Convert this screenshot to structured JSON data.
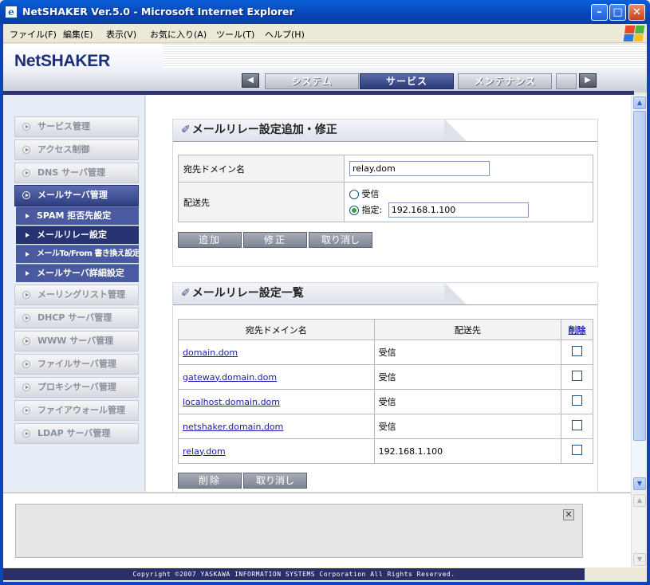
{
  "window": {
    "title": "NetSHAKER Ver.5.0 - Microsoft Internet Explorer",
    "min": "–",
    "max": "□",
    "close": "✕"
  },
  "menu": [
    "ファイル(F)",
    "編集(E)",
    "表示(V)",
    "お気に入り(A)",
    "ツール(T)",
    "ヘルプ(H)"
  ],
  "logo": "NetSHAKER",
  "tabs": {
    "prev": "◀",
    "next": "▶",
    "items": [
      "システム",
      "サービス",
      "メンテナンス"
    ],
    "active": "サービス"
  },
  "sidebar": {
    "items": [
      "サービス管理",
      "アクセス制御",
      "DNS サーバ管理",
      "メールサーバ管理",
      "メーリングリスト管理",
      "DHCP サーバ管理",
      "WWW サーバ管理",
      "ファイルサーバ管理",
      "プロキシサーバ管理",
      "ファイアウォール管理",
      "LDAP サーバ管理"
    ],
    "active": "メールサーバ管理",
    "subitems": [
      "SPAM 拒否先設定",
      "メールリレー設定",
      "メールTo/From 書き換え設定",
      "メールサーバ詳細設定"
    ],
    "current_sub": "メールリレー設定"
  },
  "form": {
    "title": "メールリレー設定追加・修正",
    "domain_label": "宛先ドメイン名",
    "domain_value": "relay.dom",
    "dest_label": "配送先",
    "radio_receive": "受信",
    "radio_specify": "指定:",
    "specify_value": "192.168.1.100",
    "selected": "指定",
    "btn_add": "追加",
    "btn_modify": "修正",
    "btn_cancel": "取り消し"
  },
  "list": {
    "title": "メールリレー設定一覧",
    "headers": [
      "宛先ドメイン名",
      "配送先",
      "削除"
    ],
    "rows": [
      {
        "domain": "domain.dom",
        "dest": "受信"
      },
      {
        "domain": "gateway.domain.dom",
        "dest": "受信"
      },
      {
        "domain": "localhost.domain.dom",
        "dest": "受信"
      },
      {
        "domain": "netshaker.domain.dom",
        "dest": "受信"
      },
      {
        "domain": "relay.dom",
        "dest": "192.168.1.100"
      }
    ],
    "btn_delete": "削除",
    "btn_cancel": "取り消し"
  },
  "lower": {
    "close": "✕"
  },
  "footer": "Copyright ©2007 YASKAWA INFORMATION SYSTEMS Corporation All Rights Reserved.",
  "colors": {
    "titlebar": "#0a5fd8",
    "nav_active": "#2f3e82",
    "accent_bar": "#2c3570",
    "link": "#1a1ab0"
  }
}
